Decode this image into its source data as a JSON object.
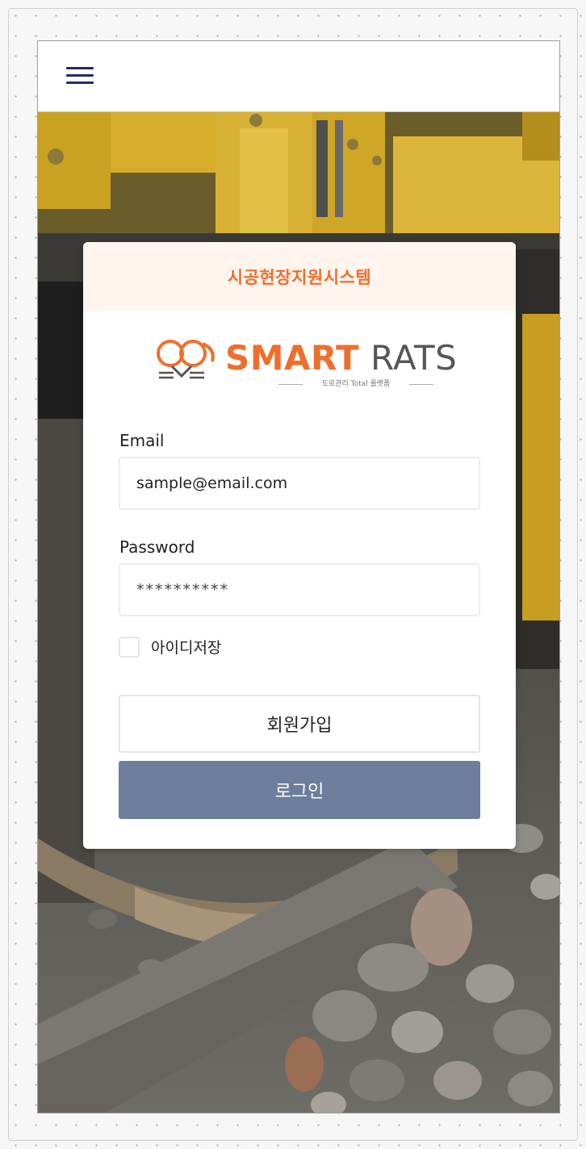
{
  "header": {
    "menu_icon": "hamburger-menu-icon"
  },
  "card": {
    "title": "시공현장지원시스템",
    "logo": {
      "brand_primary": "SMART",
      "brand_secondary": "RATS",
      "tagline": "도로관리 Total 플랫폼",
      "icon": "mouse-logo-icon"
    },
    "email": {
      "label": "Email",
      "value": "sample@email.com"
    },
    "password": {
      "label": "Password",
      "value": "**********"
    },
    "remember_id": {
      "label": "아이디저장",
      "checked": false
    },
    "signup_button": "회원가입",
    "login_button": "로그인"
  },
  "colors": {
    "accent": "#ee6f2d",
    "header_bg": "#fff4ee",
    "login_button": "#6c7e9b",
    "menu_icon": "#1f2d66"
  }
}
